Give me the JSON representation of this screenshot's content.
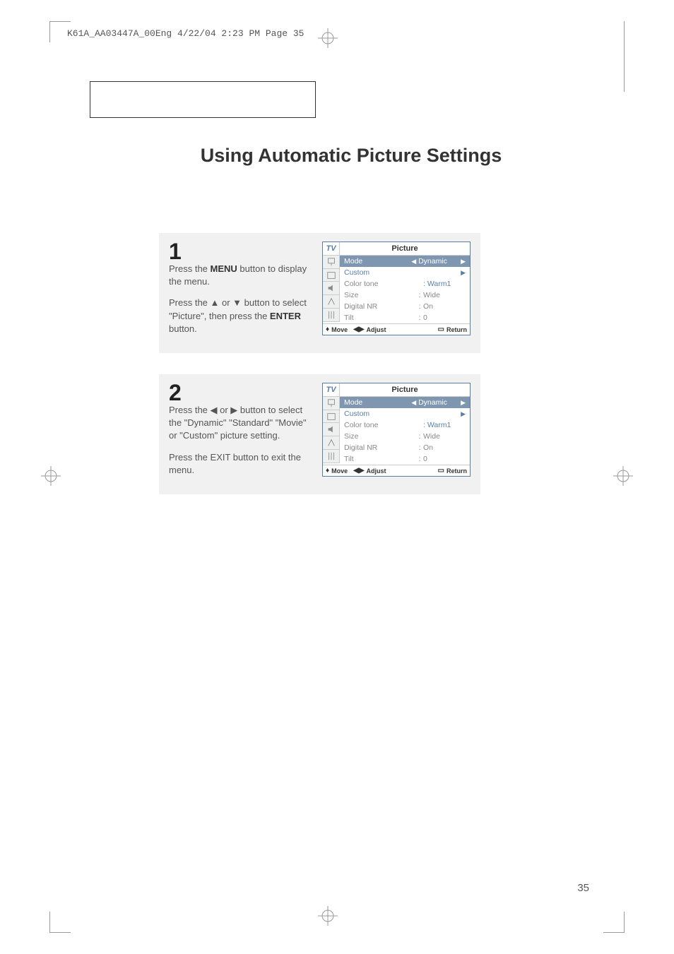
{
  "header": "K61A_AA03447A_00Eng  4/22/04  2:23 PM  Page 35",
  "title": "Using Automatic Picture Settings",
  "pageNumber": "35",
  "steps": [
    {
      "number": "1",
      "paragraphs_html": [
        "Press the <b>MENU</b> button to display the menu.",
        "Press the ▲ or ▼ button to select \"Picture\", then press the <b>ENTER</b> button."
      ]
    },
    {
      "number": "2",
      "paragraphs_html": [
        "Press the ◀ or ▶ button to select the \"Dynamic\" \"Standard\" \"Movie\" or \"Custom\" picture setting.",
        "Press the EXIT button to exit the menu."
      ]
    }
  ],
  "osd": {
    "title": "Picture",
    "sidebar": [
      "TV",
      "input",
      "picture",
      "sound",
      "channel",
      "setup"
    ],
    "rows": [
      {
        "label": "Mode",
        "value": "Dynamic",
        "selected": true,
        "arrows": true
      },
      {
        "label": "Custom",
        "custom": true,
        "rightArrow": true
      },
      {
        "label": "Color tone",
        "value": "Warm1",
        "warm": true,
        "colonPrefix": true
      },
      {
        "label": "Size",
        "value": "Wide",
        "colon": true
      },
      {
        "label": "Digital NR",
        "value": "On",
        "colon": true
      },
      {
        "label": "Tilt",
        "value": "0",
        "colon": true
      }
    ],
    "footer": {
      "move": "Move",
      "adjust": "Adjust",
      "ret": "Return"
    }
  }
}
